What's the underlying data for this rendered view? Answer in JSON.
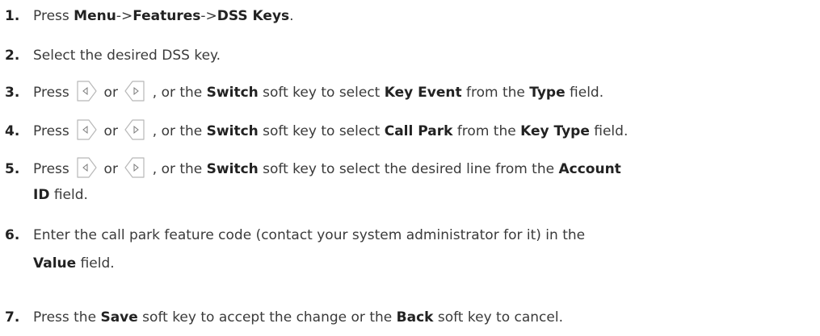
{
  "steps": [
    {
      "number": "1.",
      "prefix": "Press ",
      "menu": "Menu",
      "sep1": "->",
      "features": "Features",
      "sep2": "->",
      "dss_keys": "DSS Keys",
      "suffix": "."
    },
    {
      "number": "2.",
      "text": "Select the desired DSS key."
    },
    {
      "number": "3.",
      "prefix": "Press ",
      "or": " or ",
      "mid": " , or the ",
      "switch": "Switch",
      "mid2": " soft key to select ",
      "value": "Key Event",
      "mid3": " from the ",
      "field": "Type",
      "suffix": " field."
    },
    {
      "number": "4.",
      "prefix": "Press ",
      "or": " or ",
      "mid": " , or the ",
      "switch": "Switch",
      "mid2": " soft key to select ",
      "value": "Call Park",
      "mid3": " from the ",
      "field": "Key Type",
      "suffix": " field."
    },
    {
      "number": "5.",
      "prefix": "Press ",
      "or": " or ",
      "mid": " , or the ",
      "switch": "Switch",
      "mid2": " soft key to select the desired line from the ",
      "field": "Account",
      "line2_field": "ID",
      "line2_suffix": " field."
    },
    {
      "number": "6.",
      "text": "Enter the call park feature code (contact your system administrator for it) in the",
      "line2_field": "Value",
      "line2_suffix": " field."
    },
    {
      "number": "7.",
      "prefix": "Press the ",
      "save": "Save",
      "mid": " soft key to accept the change or the ",
      "back": "Back",
      "suffix": " soft key to cancel."
    }
  ],
  "icons": {
    "right_key": "right-navigation-key-icon",
    "left_key": "left-navigation-key-icon"
  }
}
